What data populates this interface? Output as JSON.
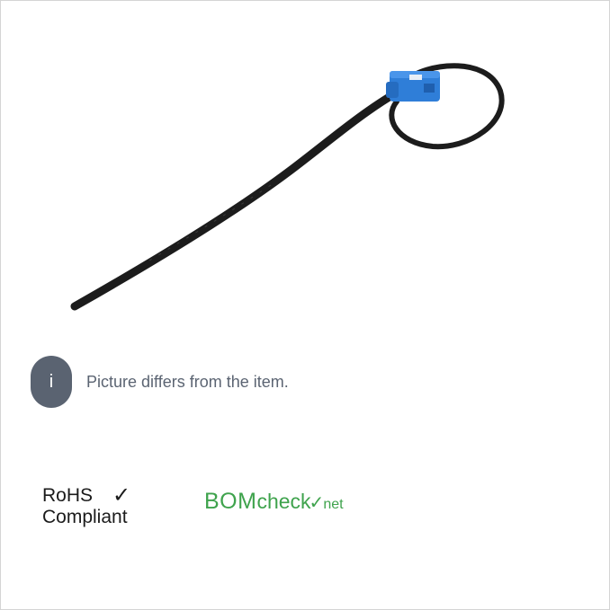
{
  "notice": {
    "icon": "info-icon",
    "icon_glyph": "i",
    "text": "Picture differs from the item."
  },
  "certifications": {
    "rohs": {
      "line1": "RoHS",
      "check_glyph": "✓",
      "line2": "Compliant"
    },
    "bomcheck": {
      "brand": "BOM",
      "check": "check",
      "tick": "✓",
      "net": "net",
      "color": "#3fa34d"
    }
  },
  "colors": {
    "cable": "#1c1c1c",
    "housing": "#2f7ed8",
    "badge": "#5a6371",
    "border": "#d4d4d4"
  }
}
